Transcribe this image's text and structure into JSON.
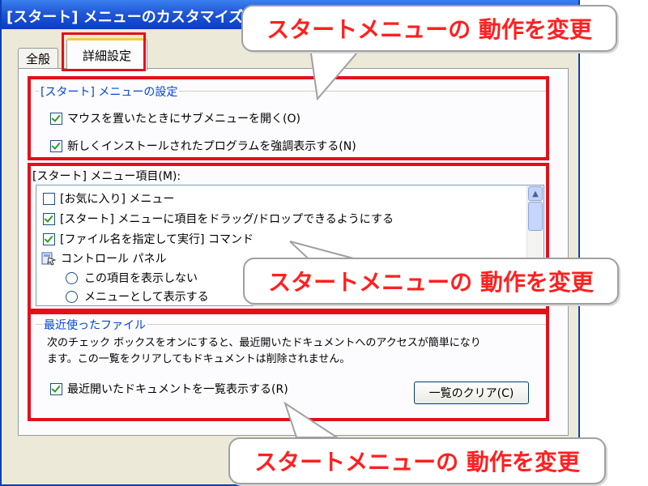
{
  "window": {
    "title": "[スタート] メニューのカスタマイズ"
  },
  "tabs": [
    {
      "label": "全般",
      "selected": false
    },
    {
      "label": "詳細設定",
      "selected": true
    }
  ],
  "start_menu_settings": {
    "legend": "[スタート] メニューの設定",
    "options": [
      {
        "label": "マウスを置いたときにサブメニューを開く(O)",
        "checked": true
      },
      {
        "label": "新しくインストールされたプログラムを強調表示する(N)",
        "checked": true
      }
    ]
  },
  "menu_items": {
    "label": "[スタート] メニュー項目(M):",
    "items": [
      {
        "label": "[お気に入り] メニュー",
        "checked": false
      },
      {
        "label": "[スタート] メニューに項目をドラッグ/ドロップできるようにする",
        "checked": true
      },
      {
        "label": "[ファイル名を指定して実行] コマンド",
        "checked": true
      },
      {
        "label": "コントロール パネル",
        "icon": "control-panel-icon"
      },
      {
        "label": "この項目を表示しない",
        "type": "radio"
      },
      {
        "label": "メニューとして表示する",
        "type": "radio"
      }
    ]
  },
  "recent_files": {
    "legend": "最近使ったファイル",
    "description_line1": "次のチェック ボックスをオンにすると、最近開いたドキュメントへのアクセスが簡単になり",
    "description_line2": "ます。この一覧をクリアしてもドキュメントは削除されません。",
    "option": {
      "label": "最近開いたドキュメントを一覧表示する(R)",
      "checked": true
    },
    "clear_button": "一覧のクリア(C)"
  },
  "callouts": [
    {
      "text": "スタートメニューの 動作を変更"
    },
    {
      "text": "スタートメニューの 動作を変更"
    },
    {
      "text": "スタートメニューの 動作を変更"
    }
  ],
  "colors": {
    "highlight": "#e3101b",
    "callout_text": "#ff2020",
    "group_legend": "#0046d5"
  }
}
